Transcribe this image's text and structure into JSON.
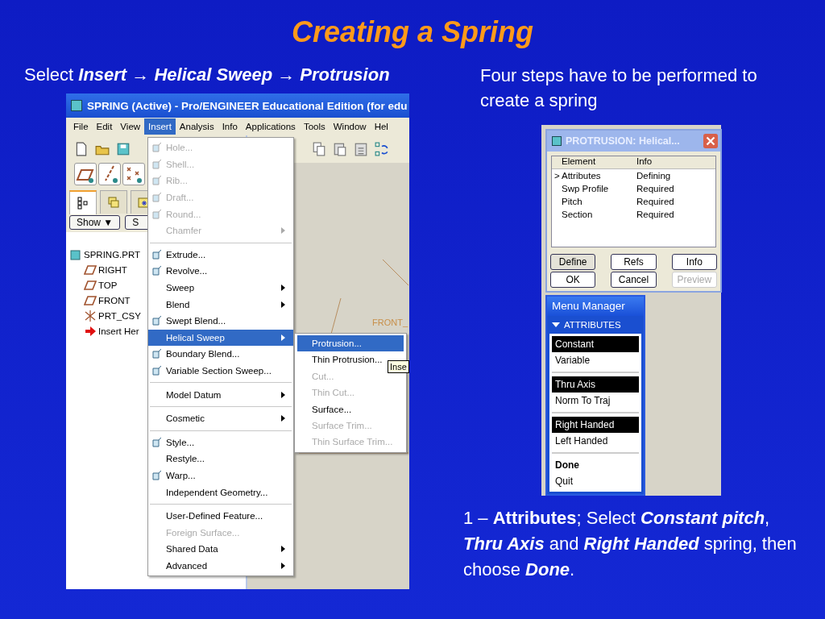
{
  "title": "Creating a Spring",
  "instruction": {
    "lead": "Select",
    "path": "Insert → Helical Sweep → Protrusion"
  },
  "app_window": {
    "title": "SPRING (Active) - Pro/ENGINEER Educational Edition (for edu",
    "menubar": [
      {
        "label": "File",
        "selected": false
      },
      {
        "label": "Edit",
        "selected": false
      },
      {
        "label": "View",
        "selected": false
      },
      {
        "label": "Insert",
        "selected": true
      },
      {
        "label": "Analysis",
        "selected": false
      },
      {
        "label": "Info",
        "selected": false
      },
      {
        "label": "Applications",
        "selected": false
      },
      {
        "label": "Tools",
        "selected": false
      },
      {
        "label": "Window",
        "selected": false
      },
      {
        "label": "Hel",
        "selected": false
      }
    ],
    "show_button": "Show ▼",
    "second_button": "S",
    "model_tree": [
      {
        "label": "SPRING.PRT",
        "kind": "part"
      },
      {
        "label": "RIGHT",
        "kind": "plane"
      },
      {
        "label": "TOP",
        "kind": "plane"
      },
      {
        "label": "FRONT",
        "kind": "plane"
      },
      {
        "label": "PRT_CSY",
        "kind": "csys"
      },
      {
        "label": "Insert Her",
        "kind": "insert"
      }
    ],
    "canvas_label": "FRONT_",
    "insert_menu": [
      {
        "kind": "item",
        "label": "Hole...",
        "disabled": true,
        "icon": true,
        "submenu": false,
        "selected": false
      },
      {
        "kind": "item",
        "label": "Shell...",
        "disabled": true,
        "icon": true,
        "submenu": false,
        "selected": false
      },
      {
        "kind": "item",
        "label": "Rib...",
        "disabled": true,
        "icon": true,
        "submenu": false,
        "selected": false
      },
      {
        "kind": "item",
        "label": "Draft...",
        "disabled": true,
        "icon": true,
        "submenu": false,
        "selected": false
      },
      {
        "kind": "item",
        "label": "Round...",
        "disabled": true,
        "icon": true,
        "submenu": false,
        "selected": false
      },
      {
        "kind": "item",
        "label": "Chamfer",
        "disabled": true,
        "icon": false,
        "submenu": true,
        "selected": false
      },
      {
        "kind": "separator"
      },
      {
        "kind": "item",
        "label": "Extrude...",
        "disabled": false,
        "icon": true,
        "submenu": false,
        "selected": false
      },
      {
        "kind": "item",
        "label": "Revolve...",
        "disabled": false,
        "icon": true,
        "submenu": false,
        "selected": false
      },
      {
        "kind": "item",
        "label": "Sweep",
        "disabled": false,
        "icon": false,
        "submenu": true,
        "selected": false
      },
      {
        "kind": "item",
        "label": "Blend",
        "disabled": false,
        "icon": false,
        "submenu": true,
        "selected": false
      },
      {
        "kind": "item",
        "label": "Swept Blend...",
        "disabled": false,
        "icon": true,
        "submenu": false,
        "selected": false
      },
      {
        "kind": "item",
        "label": "Helical Sweep",
        "disabled": false,
        "icon": false,
        "submenu": true,
        "selected": true
      },
      {
        "kind": "item",
        "label": "Boundary Blend...",
        "disabled": false,
        "icon": true,
        "submenu": false,
        "selected": false
      },
      {
        "kind": "item",
        "label": "Variable Section Sweep...",
        "disabled": false,
        "icon": true,
        "submenu": false,
        "selected": false
      },
      {
        "kind": "separator"
      },
      {
        "kind": "item",
        "label": "Model Datum",
        "disabled": false,
        "icon": false,
        "submenu": true,
        "selected": false
      },
      {
        "kind": "separator"
      },
      {
        "kind": "item",
        "label": "Cosmetic",
        "disabled": false,
        "icon": false,
        "submenu": true,
        "selected": false
      },
      {
        "kind": "separator"
      },
      {
        "kind": "item",
        "label": "Style...",
        "disabled": false,
        "icon": true,
        "submenu": false,
        "selected": false
      },
      {
        "kind": "item",
        "label": "Restyle...",
        "disabled": false,
        "icon": false,
        "submenu": false,
        "selected": false
      },
      {
        "kind": "item",
        "label": "Warp...",
        "disabled": false,
        "icon": true,
        "submenu": false,
        "selected": false
      },
      {
        "kind": "item",
        "label": "Independent Geometry...",
        "disabled": false,
        "icon": false,
        "submenu": false,
        "selected": false
      },
      {
        "kind": "separator"
      },
      {
        "kind": "item",
        "label": "User-Defined Feature...",
        "disabled": false,
        "icon": false,
        "submenu": false,
        "selected": false
      },
      {
        "kind": "item",
        "label": "Foreign Surface...",
        "disabled": true,
        "icon": false,
        "submenu": false,
        "selected": false
      },
      {
        "kind": "item",
        "label": "Shared Data",
        "disabled": false,
        "icon": false,
        "submenu": true,
        "selected": false
      },
      {
        "kind": "item",
        "label": "Advanced",
        "disabled": false,
        "icon": false,
        "submenu": true,
        "selected": false
      }
    ],
    "helical_submenu": [
      {
        "label": "Protrusion...",
        "disabled": false,
        "selected": true
      },
      {
        "label": "Thin Protrusion...",
        "disabled": false,
        "selected": false
      },
      {
        "label": "Cut...",
        "disabled": true,
        "selected": false
      },
      {
        "label": "Thin Cut...",
        "disabled": true,
        "selected": false
      },
      {
        "label": "Surface...",
        "disabled": false,
        "selected": false
      },
      {
        "label": "Surface Trim...",
        "disabled": true,
        "selected": false
      },
      {
        "label": "Thin Surface Trim...",
        "disabled": true,
        "selected": false
      }
    ],
    "tooltip": "Inse"
  },
  "note": "Four steps have to be performed to create a spring",
  "dialog": {
    "title": "PROTRUSION: Helical...",
    "columns": [
      "Element",
      "Info"
    ],
    "rows": [
      {
        "marker": ">",
        "element": "Attributes",
        "info": "Defining"
      },
      {
        "element": "Swp Profile",
        "info": "Required"
      },
      {
        "element": "Pitch",
        "info": "Required"
      },
      {
        "element": "Section",
        "info": "Required"
      }
    ],
    "buttons": [
      {
        "label": "Define",
        "pressed": true,
        "disabled": false
      },
      {
        "label": "Refs",
        "pressed": false,
        "disabled": false
      },
      {
        "label": "Info",
        "pressed": false,
        "disabled": false
      },
      {
        "label": "OK",
        "pressed": false,
        "disabled": false
      },
      {
        "label": "Cancel",
        "pressed": false,
        "disabled": false
      },
      {
        "label": "Preview",
        "pressed": false,
        "disabled": true
      }
    ]
  },
  "menu_manager": {
    "title": "Menu Manager",
    "section": "ATTRIBUTES",
    "groups": [
      [
        {
          "label": "Constant",
          "selected": true
        },
        {
          "label": "Variable",
          "selected": false
        }
      ],
      [
        {
          "label": "Thru Axis",
          "selected": true
        },
        {
          "label": "Norm To Traj",
          "selected": false
        }
      ],
      [
        {
          "label": "Right Handed",
          "selected": true
        },
        {
          "label": "Left Handed",
          "selected": false
        }
      ],
      [
        {
          "label": "Done",
          "selected": false,
          "kind": "command"
        },
        {
          "label": "Quit",
          "selected": false,
          "kind": "item"
        }
      ]
    ]
  },
  "caption": [
    {
      "text": "1 – ",
      "kind": "plain"
    },
    {
      "text": "Attributes",
      "kind": "bold"
    },
    {
      "text": "; Select ",
      "kind": "plain"
    },
    {
      "text": "Constant pitch",
      "kind": "emphasis"
    },
    {
      "text": ", ",
      "kind": "plain"
    },
    {
      "text": "Thru Axis",
      "kind": "emphasis"
    },
    {
      "text": " and ",
      "kind": "plain"
    },
    {
      "text": "Right Handed",
      "kind": "emphasis"
    },
    {
      "text": " spring, then choose ",
      "kind": "plain"
    },
    {
      "text": "Done",
      "kind": "emphasis"
    },
    {
      "text": ".",
      "kind": "plain"
    }
  ]
}
